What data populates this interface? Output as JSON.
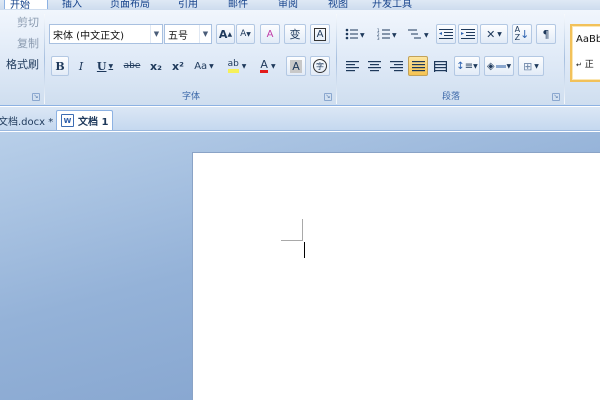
{
  "ribbon_tabs": [
    "开始",
    "插入",
    "页面布局",
    "引用",
    "邮件",
    "审阅",
    "视图",
    "开发工具"
  ],
  "clipboard": {
    "cut": "剪切",
    "copy": "复制",
    "format_painter": "格式刷"
  },
  "font": {
    "group_label": "字体",
    "font_name": "宋体 (中文正文)",
    "font_size": "五号",
    "grow": "A",
    "shrink": "A",
    "clear_format": "A",
    "phonetic": "wén",
    "char_border": "A",
    "bold": "B",
    "italic": "I",
    "underline": "U",
    "strikethrough": "abe",
    "subscript": "x₂",
    "superscript": "x²",
    "change_case": "Aa",
    "highlight": "ab",
    "font_color": "A",
    "char_shading": "A",
    "enclose": "字"
  },
  "paragraph": {
    "group_label": "段落"
  },
  "styles": {
    "preview": "AaBb",
    "style_name": "正"
  },
  "doc_tabs": [
    "文档.docx *",
    "文档 1"
  ],
  "colors": {
    "accent": "#8db2e3",
    "highlight_yellow": "#f5f05a",
    "font_red": "#e31b1b",
    "pressed": "#f6c351"
  }
}
